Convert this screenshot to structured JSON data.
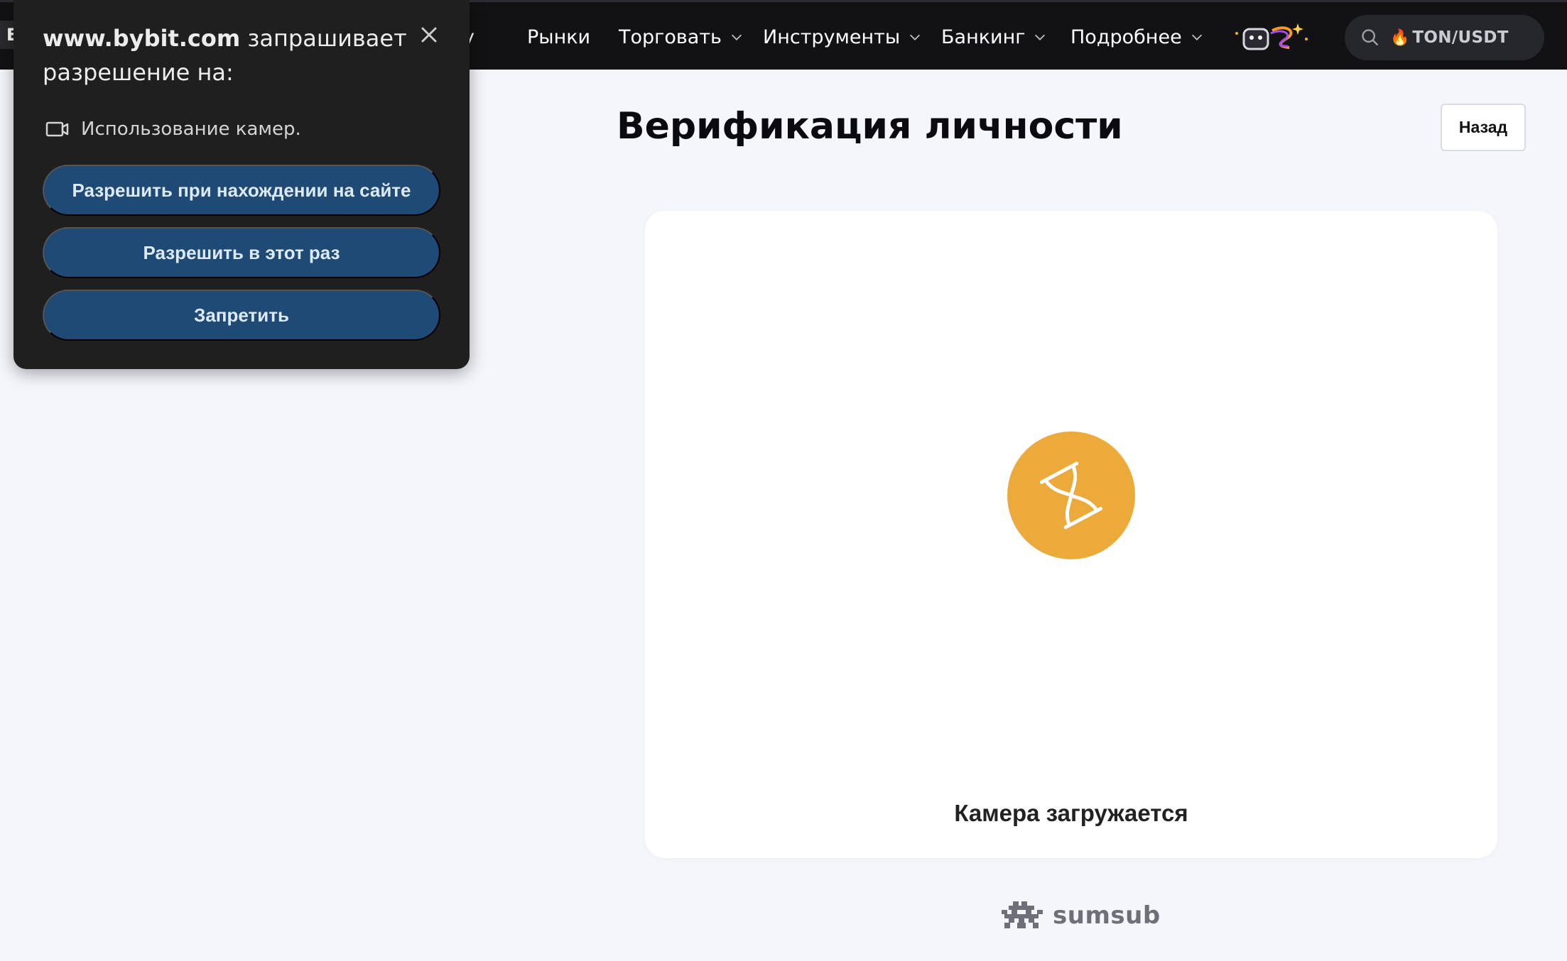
{
  "nav": {
    "logo_letter": "E",
    "partial_item": "y",
    "items": [
      {
        "label": "Рынки",
        "has_dropdown": false
      },
      {
        "label": "Торговать",
        "has_dropdown": true
      },
      {
        "label": "Инструменты",
        "has_dropdown": true
      },
      {
        "label": "Банкинг",
        "has_dropdown": true
      },
      {
        "label": "Подробнее",
        "has_dropdown": true
      }
    ],
    "search": {
      "icon": "fire-icon",
      "value": "TON/USDT"
    }
  },
  "main": {
    "title": "Верификация личности",
    "back_label": "Назад",
    "camera_status": "Камера загружается",
    "powered_by": "sumsub",
    "accent_color": "#ecaa3b"
  },
  "permission_popup": {
    "site": "www.bybit.com",
    "request_text": " запрашивает разрешение на:",
    "permission": "Использование камер.",
    "buttons": {
      "allow_on_site": "Разрешить при нахождении на сайте",
      "allow_once": "Разрешить в этот раз",
      "deny": "Запретить"
    }
  }
}
